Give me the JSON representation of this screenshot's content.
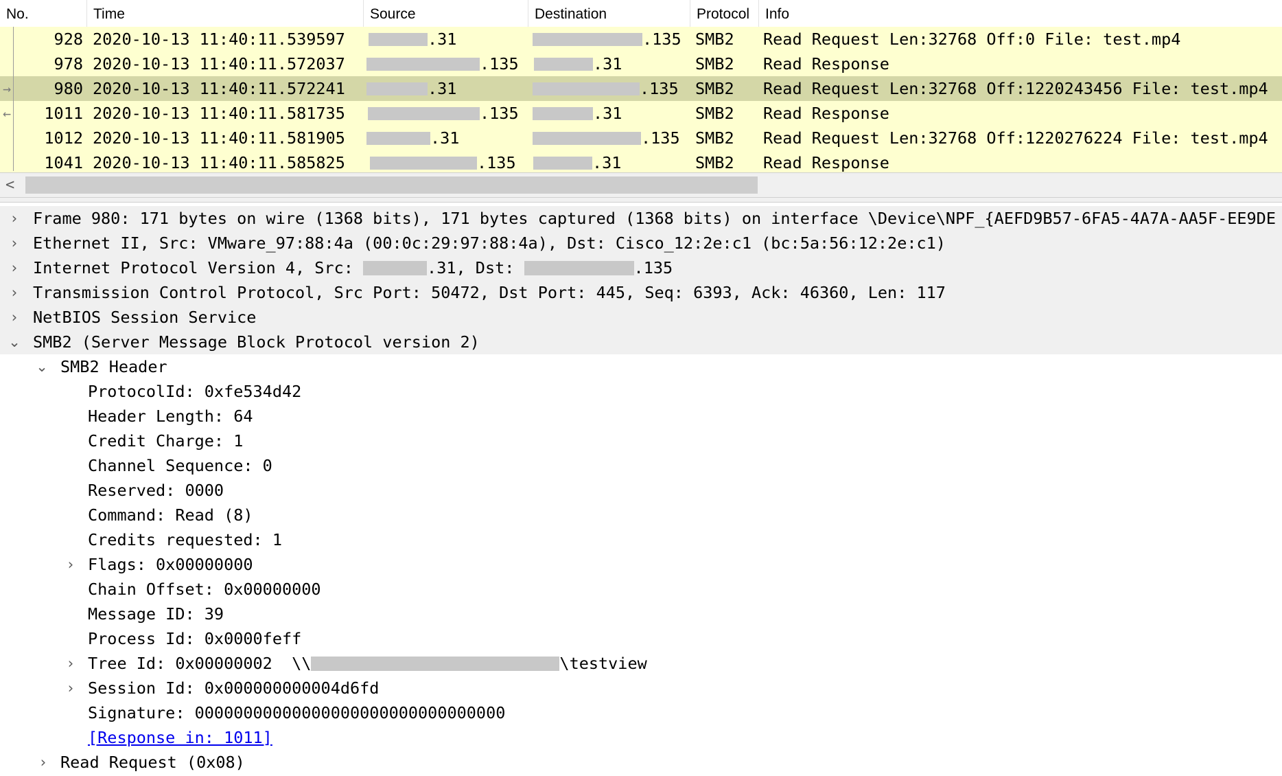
{
  "packet_list": {
    "columns": [
      "No.",
      "Time",
      "Source",
      "Destination",
      "Protocol",
      "Info"
    ],
    "rows": [
      {
        "no": "928",
        "time": "2020-10-13 11:40:11.539597",
        "src_suffix": ".31",
        "dst_suffix": ".135",
        "protocol": "SMB2",
        "info": "Read Request Len:32768 Off:0 File: test.mp4",
        "selected": false,
        "marker": ""
      },
      {
        "no": "978",
        "time": "2020-10-13 11:40:11.572037",
        "src_suffix": ".135",
        "dst_suffix": ".31",
        "protocol": "SMB2",
        "info": "Read Response",
        "selected": false,
        "marker": ""
      },
      {
        "no": "980",
        "time": "2020-10-13 11:40:11.572241",
        "src_suffix": ".31",
        "dst_suffix": ".135",
        "protocol": "SMB2",
        "info": "Read Request Len:32768 Off:1220243456 File: test.mp4",
        "selected": true,
        "marker": "request"
      },
      {
        "no": "1011",
        "time": "2020-10-13 11:40:11.581735",
        "src_suffix": ".135",
        "dst_suffix": ".31",
        "protocol": "SMB2",
        "info": "Read Response",
        "selected": false,
        "marker": "response"
      },
      {
        "no": "1012",
        "time": "2020-10-13 11:40:11.581905",
        "src_suffix": ".31",
        "dst_suffix": ".135",
        "protocol": "SMB2",
        "info": "Read Request Len:32768 Off:1220276224 File: test.mp4",
        "selected": false,
        "marker": ""
      },
      {
        "no": "1041",
        "time": "2020-10-13 11:40:11.585825",
        "src_suffix": ".135",
        "dst_suffix": ".31",
        "protocol": "SMB2",
        "info": "Read Response",
        "selected": false,
        "marker": ""
      }
    ],
    "scroll_left_icon": "<"
  },
  "details": {
    "frame": "Frame 980: 171 bytes on wire (1368 bits), 171 bytes captured (1368 bits) on interface \\Device\\NPF_{AEFD9B57-6FA5-4A7A-AA5F-EE9DE",
    "ethernet": "Ethernet II, Src: VMware_97:88:4a (00:0c:29:97:88:4a), Dst: Cisco_12:2e:c1 (bc:5a:56:12:2e:c1)",
    "ip_prefix": "Internet Protocol Version 4, Src:",
    "ip_src_suffix": ".31,",
    "ip_dst_label": "Dst:",
    "ip_dst_suffix": ".135",
    "tcp": "Transmission Control Protocol, Src Port: 50472, Dst Port: 445, Seq: 6393, Ack: 46360, Len: 117",
    "netbios": "NetBIOS Session Service",
    "smb2": "SMB2 (Server Message Block Protocol version 2)",
    "smb2_header": "SMB2 Header",
    "protocol_id": "ProtocolId: 0xfe534d42",
    "header_length": "Header Length: 64",
    "credit_charge": "Credit Charge: 1",
    "channel_sequence": "Channel Sequence: 0",
    "reserved": "Reserved: 0000",
    "command": "Command: Read (8)",
    "credits_requested": "Credits requested: 1",
    "flags": "Flags: 0x00000000",
    "chain_offset": "Chain Offset: 0x00000000",
    "message_id": "Message ID: 39",
    "process_id": "Process Id: 0x0000feff",
    "tree_id_prefix": "Tree Id: 0x00000002  \\\\",
    "tree_id_suffix": "\\testview",
    "session_id": "Session Id: 0x000000000004d6fd",
    "signature": "Signature: 00000000000000000000000000000000",
    "response_in": "[Response in: 1011]",
    "read_request": "Read Request (0x08)"
  },
  "icons": {
    "collapsed": "chevron-right-icon",
    "expanded": "chevron-down-icon"
  }
}
